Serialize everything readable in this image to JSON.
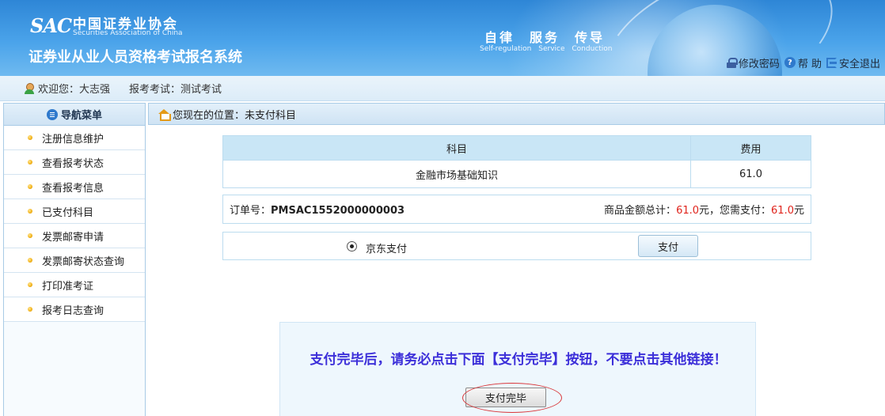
{
  "header": {
    "logo_mark": "SAC",
    "org_cn": "中国证券业协会",
    "org_en": "Securities Association of China",
    "system_title": "证券业从业人员资格考试报名系统",
    "motto_cn": "自律　服务　传导",
    "motto_en": "Self-regulation Service Conduction",
    "links": {
      "change_password": "修改密码",
      "help": "帮 助",
      "logout": "安全退出"
    }
  },
  "welcome": {
    "greeting": "欢迎您：大志强",
    "exam": "报考考试：测试考试"
  },
  "sidebar": {
    "title": "导航菜单",
    "items": [
      {
        "label": "注册信息维护"
      },
      {
        "label": "查看报考状态"
      },
      {
        "label": "查看报考信息"
      },
      {
        "label": "已支付科目"
      },
      {
        "label": "发票邮寄申请"
      },
      {
        "label": "发票邮寄状态查询"
      },
      {
        "label": "打印准考证"
      },
      {
        "label": "报考日志查询"
      }
    ]
  },
  "breadcrumb": {
    "text": "您现在的位置：未支付科目"
  },
  "fee_table": {
    "headers": [
      "科目",
      "费用"
    ],
    "rows": [
      {
        "subject": "金融市场基础知识",
        "fee": "61.0"
      }
    ]
  },
  "order": {
    "label": "订单号：",
    "number": "PMSAC1552000000003",
    "total_label": "商品金额总计：",
    "total_value": "61.0",
    "unit1": "元，您需支付：",
    "pay_value": "61.0",
    "unit2": "元"
  },
  "payment": {
    "method": "京东支付",
    "pay_button": "支付"
  },
  "notice": {
    "text": "支付完毕后，请务必点击下面【支付完毕】按钮，不要点击其他链接！",
    "done_button": "支付完毕"
  },
  "colors": {
    "header_blue": "#2e86d6",
    "notice_text": "#3c2fd9",
    "amount_red": "#e0241c",
    "circle_red": "#d9373a"
  }
}
